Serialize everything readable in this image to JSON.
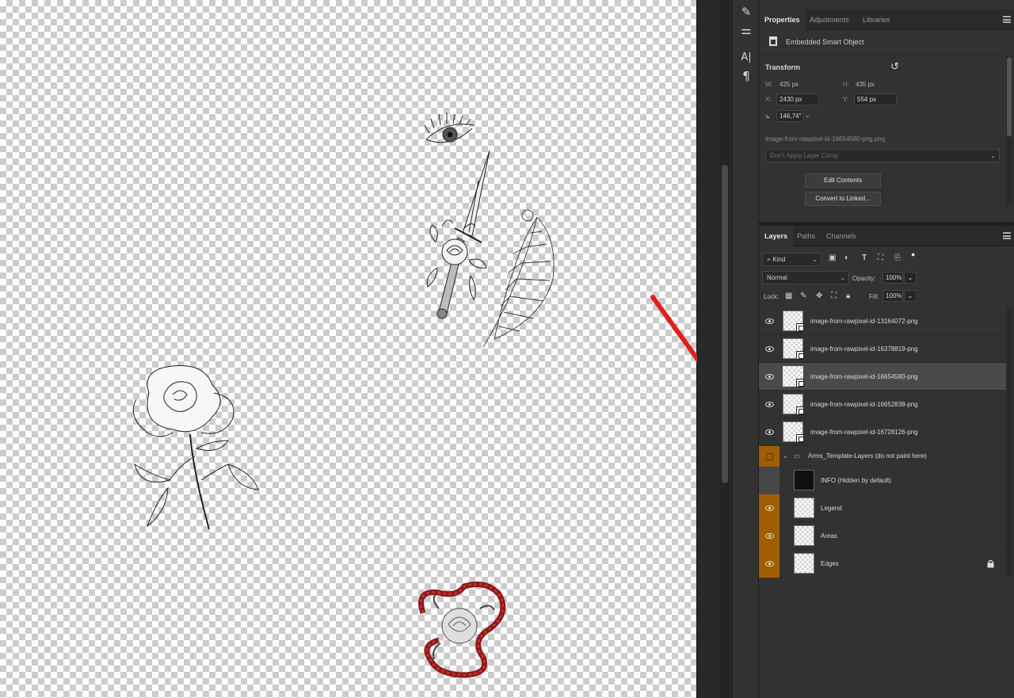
{
  "tools": [
    {
      "icon": "brush-settings-icon",
      "glyph": "✎"
    },
    {
      "icon": "adjust-sliders-icon",
      "glyph": "⚌"
    },
    {
      "icon": "character-panel-icon",
      "glyph": "A|"
    },
    {
      "icon": "paragraph-panel-icon",
      "glyph": "¶"
    }
  ],
  "properties": {
    "tabs": [
      "Properties",
      "Adjustments",
      "Libraries"
    ],
    "object_type": "Embedded Smart Object",
    "transform_heading": "Transform",
    "w_label": "W:",
    "w_value": "425 px",
    "h_label": "H:",
    "h_value": "435 px",
    "x_label": "X:",
    "x_value": "2430 px",
    "y_label": "Y:",
    "y_value": "554 px",
    "angle_value": "146,74°",
    "filename": "image-from-rawpixel-id-16654580-png.png",
    "layer_comp": "Don't Apply Layer Comp",
    "edit_contents": "Edit Contents",
    "convert_linked": "Convert to Linked..."
  },
  "layers_panel": {
    "tabs": [
      "Layers",
      "Paths",
      "Channels"
    ],
    "filter_kind": "Kind",
    "blend_mode": "Normal",
    "opacity_label": "Opacity:",
    "opacity_value": "100%",
    "lock_label": "Lock:",
    "fill_label": "Fill:",
    "fill_value": "100%",
    "layers": [
      {
        "name": "image-from-rawpixel-id-13164072-png",
        "visible": true,
        "selected": false,
        "type": "smart"
      },
      {
        "name": "image-from-rawpixel-id-16378819-png",
        "visible": true,
        "selected": false,
        "type": "smart"
      },
      {
        "name": "image-from-rawpixel-id-16654580-png",
        "visible": true,
        "selected": true,
        "type": "smart"
      },
      {
        "name": "image-from-rawpixel-id-16652838-png",
        "visible": true,
        "selected": false,
        "type": "smart"
      },
      {
        "name": "image-from-rawpixel-id-16728126-png",
        "visible": true,
        "selected": false,
        "type": "smart"
      },
      {
        "name": "Arms_Template-Layers (do not paint here)",
        "visible": false,
        "selected": false,
        "type": "group"
      },
      {
        "name": "INFO (Hidden by default)",
        "visible": false,
        "selected": false,
        "type": "info"
      },
      {
        "name": "Legend",
        "visible": true,
        "selected": false,
        "type": "child"
      },
      {
        "name": "Areas",
        "visible": true,
        "selected": false,
        "type": "child"
      },
      {
        "name": "Edges",
        "visible": true,
        "selected": false,
        "type": "child",
        "locked": true
      }
    ]
  },
  "colors": {
    "panel_bg": "#323232",
    "group_color_tag": "#a05e00",
    "annotation_red": "#e02020"
  }
}
